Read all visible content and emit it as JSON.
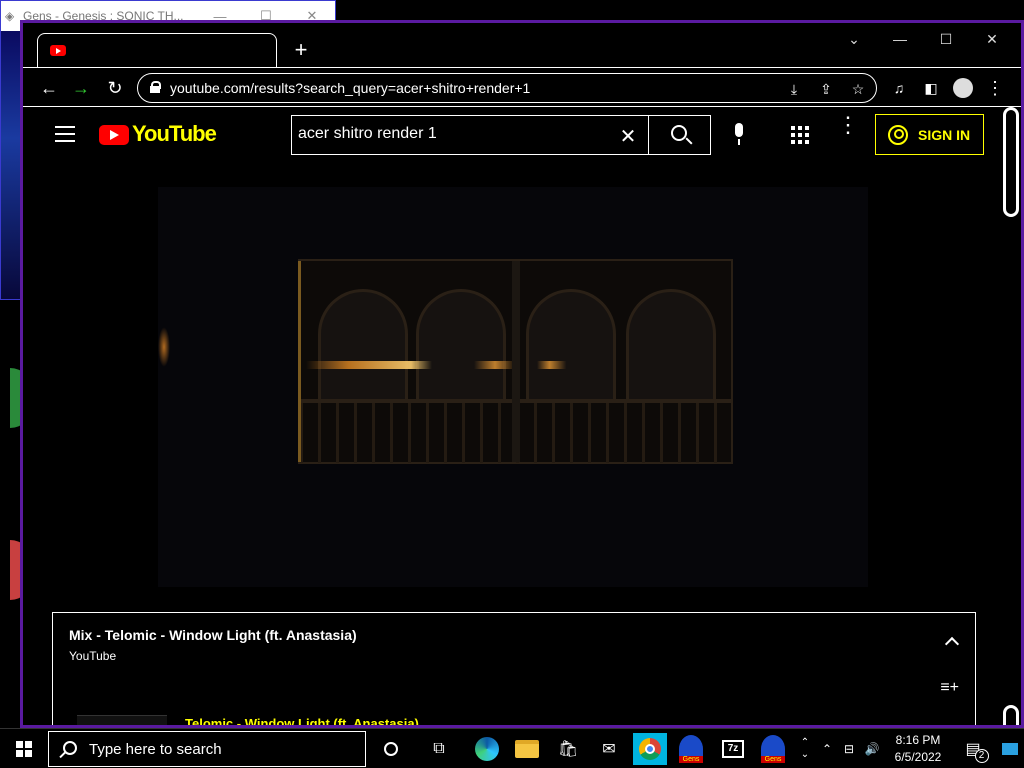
{
  "gens_window": {
    "title": "Gens - Genesis : SONIC TH...",
    "minimize": "—",
    "maximize": "☐",
    "close": "✕"
  },
  "browser": {
    "new_tab": "+",
    "url": "youtube.com/results?search_query=acer+shitro+render+1",
    "window_controls": {
      "dropdown": "⌄",
      "minimize": "—",
      "maximize": "☐",
      "close": "✕"
    }
  },
  "youtube": {
    "logo_text": "YouTube",
    "search_query": "acer shitro render 1",
    "sign_in": "SIGN IN",
    "more_options": "⋮"
  },
  "playlist": {
    "title": "Mix - Telomic - Window Light (ft. Anastasia)",
    "channel": "YouTube",
    "first_item": "Telomic - Window Light (ft. Anastasia)"
  },
  "taskbar": {
    "search_placeholder": "Type here to search",
    "time": "8:16 PM",
    "date": "6/5/2022",
    "notifications_count": "2",
    "zip_label": "7z"
  },
  "colors": {
    "accent_yellow": "#ffff00",
    "window_border": "#5a1aa0",
    "taskbar_active": "#00b4e0"
  }
}
